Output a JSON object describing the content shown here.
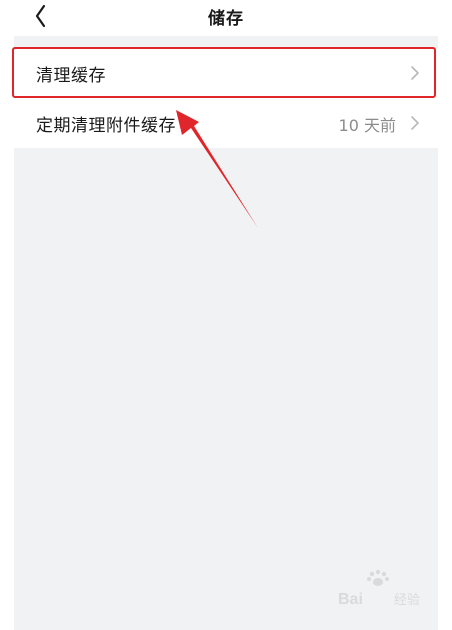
{
  "header": {
    "title": "储存"
  },
  "rows": [
    {
      "label": "清理缓存",
      "value": ""
    },
    {
      "label": "定期清理附件缓存",
      "value": "10 天前"
    }
  ],
  "icons": {
    "back": "chevron-left-icon",
    "row_chevron": "chevron-right-icon"
  },
  "colors": {
    "highlight": "#e0262a",
    "background": "#f1f2f4"
  }
}
